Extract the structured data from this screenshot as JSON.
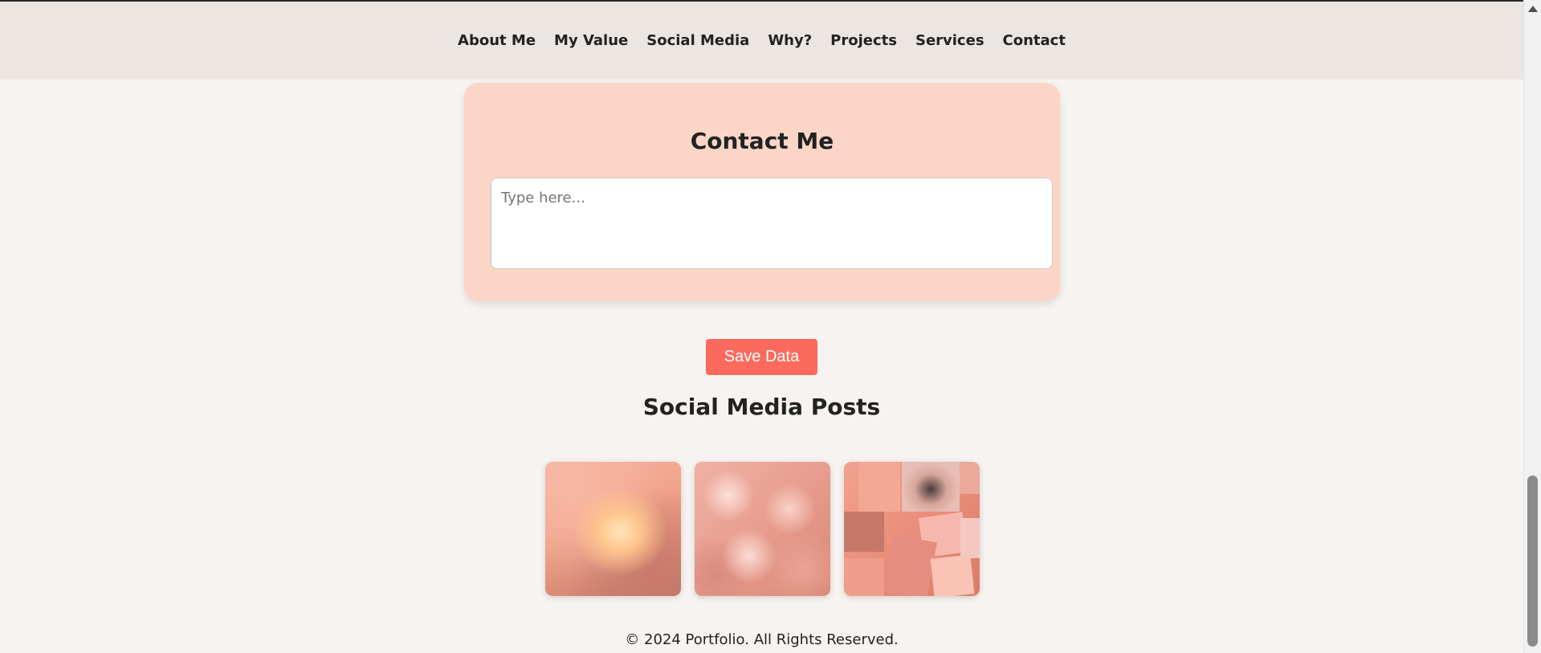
{
  "navbar": {
    "links": [
      {
        "label": "About Me"
      },
      {
        "label": "My Value"
      },
      {
        "label": "Social Media"
      },
      {
        "label": "Why?"
      },
      {
        "label": "Projects"
      },
      {
        "label": "Services"
      },
      {
        "label": "Contact"
      }
    ]
  },
  "contact": {
    "title": "Contact Me",
    "placeholder": "Type here...",
    "value": ""
  },
  "save_button": {
    "label": "Save Data"
  },
  "social_posts": {
    "heading": "Social Media Posts",
    "thumbnails": [
      "sunset-sky-image",
      "pink-jelly-blobs-image",
      "peach-aesthetic-collage-image"
    ]
  },
  "footer": {
    "copyright": "© 2024 Portfolio. All Rights Reserved."
  },
  "colors": {
    "page_background": "#f7f3f0",
    "navbar_background": "#ebe6e1",
    "contact_card_background": "#fbd6c7",
    "button_accent": "#fa6b5e",
    "text": "#222222"
  }
}
